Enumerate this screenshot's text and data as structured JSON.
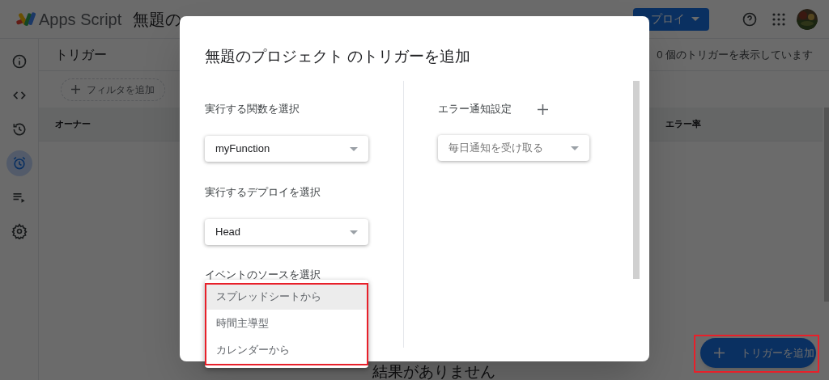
{
  "header": {
    "app_name": "Apps Script",
    "project_title": "無題の",
    "deploy_button": "プロイ"
  },
  "sidebar": {
    "items": [
      {
        "kind": "info",
        "selected": false
      },
      {
        "kind": "code",
        "selected": false
      },
      {
        "kind": "history",
        "selected": false
      },
      {
        "kind": "alarm",
        "selected": true
      },
      {
        "kind": "executions",
        "selected": false
      },
      {
        "kind": "settings",
        "selected": false
      }
    ]
  },
  "page": {
    "title": "トリガー",
    "count_text": "0 個のトリガーを表示しています",
    "filter_chip": "フィルタを追加",
    "columns": [
      "オーナー",
      "エラー率"
    ],
    "empty_text": "結果がありません",
    "add_button": "トリガーを追加"
  },
  "dialog": {
    "title": "無題のプロジェクト のトリガーを追加",
    "left": [
      {
        "label": "実行する関数を選択",
        "value": "myFunction"
      },
      {
        "label": "実行するデプロイを選択",
        "value": "Head"
      }
    ],
    "event_source": {
      "label": "イベントのソースを選択",
      "options": [
        {
          "label": "スプレッドシートから",
          "selected": true
        },
        {
          "label": "時間主導型",
          "selected": false
        },
        {
          "label": "カレンダーから",
          "selected": false
        }
      ]
    },
    "error_notify": {
      "label": "エラー通知設定",
      "value": "毎日通知を受け取る"
    }
  }
}
